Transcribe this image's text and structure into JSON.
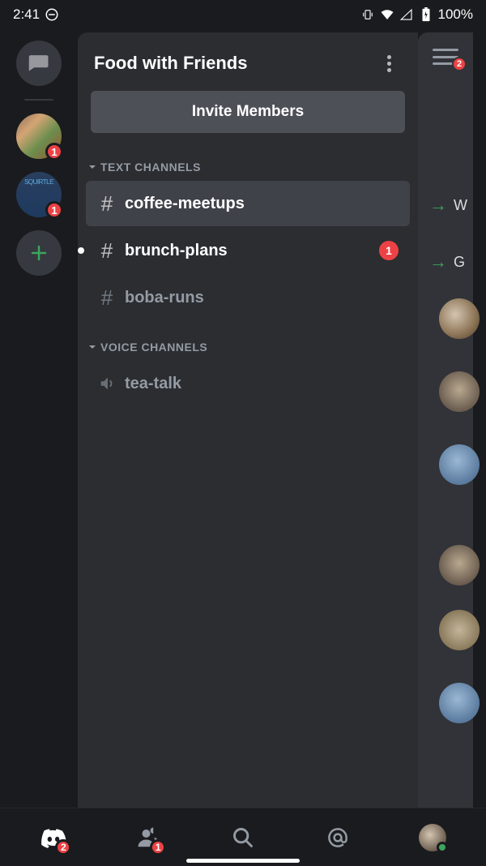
{
  "statusBar": {
    "time": "2:41",
    "battery": "100%"
  },
  "server": {
    "title": "Food with Friends",
    "inviteLabel": "Invite Members"
  },
  "sections": {
    "text": "TEXT CHANNELS",
    "voice": "VOICE CHANNELS"
  },
  "channels": {
    "text": [
      {
        "name": "coffee-meetups",
        "selected": true,
        "unread": false,
        "badge": null
      },
      {
        "name": "brunch-plans",
        "selected": false,
        "unread": true,
        "badge": "1"
      },
      {
        "name": "boba-runs",
        "selected": false,
        "unread": false,
        "badge": null
      }
    ],
    "voice": [
      {
        "name": "tea-talk"
      }
    ]
  },
  "serverRail": {
    "servers": [
      {
        "badge": "1"
      },
      {
        "badge": "1"
      }
    ]
  },
  "peek": {
    "hamburgerBadge": "2",
    "rows": [
      {
        "letter": "W"
      },
      {
        "letter": "G"
      }
    ]
  },
  "bottomNav": {
    "discordBadge": "2",
    "friendsBadge": "1"
  }
}
